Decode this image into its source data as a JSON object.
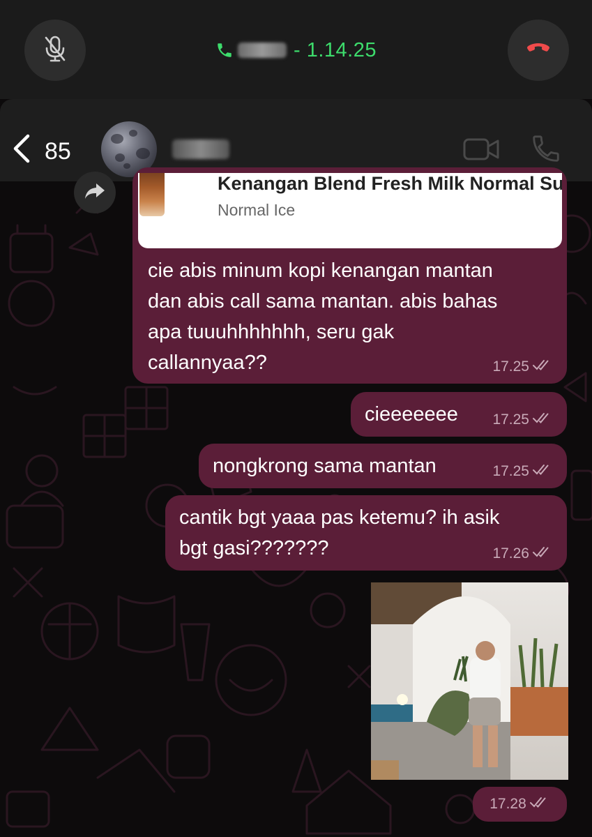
{
  "call": {
    "duration_text": "- 1.14.25",
    "mute_icon": "mic-off-icon",
    "end_icon": "end-call-icon"
  },
  "header": {
    "back_count": "85",
    "video_icon": "video-call-icon",
    "voice_icon": "voice-call-icon"
  },
  "quoted": {
    "title": "Kenangan Blend Fresh Milk Normal Su",
    "subtitle": "Normal Ice"
  },
  "messages": [
    {
      "text": "cie abis minum kopi kenangan mantan\ndan abis call sama mantan. abis bahas\napa tuuuhhhhhhh, seru gak\ncallannyaa??",
      "time": "17.25"
    },
    {
      "text": "cieeeeeee",
      "time": "17.25"
    },
    {
      "text": "nongkrong sama mantan",
      "time": "17.25"
    },
    {
      "text": "cantik bgt yaaa pas ketemu? ih asik\nbgt gasi???????",
      "time": "17.26"
    }
  ],
  "photo_message": {
    "time": "17.28"
  },
  "colors": {
    "bubble": "#5b1e38",
    "call_green": "#3ddc6c",
    "end_call_red": "#f04b4b"
  }
}
